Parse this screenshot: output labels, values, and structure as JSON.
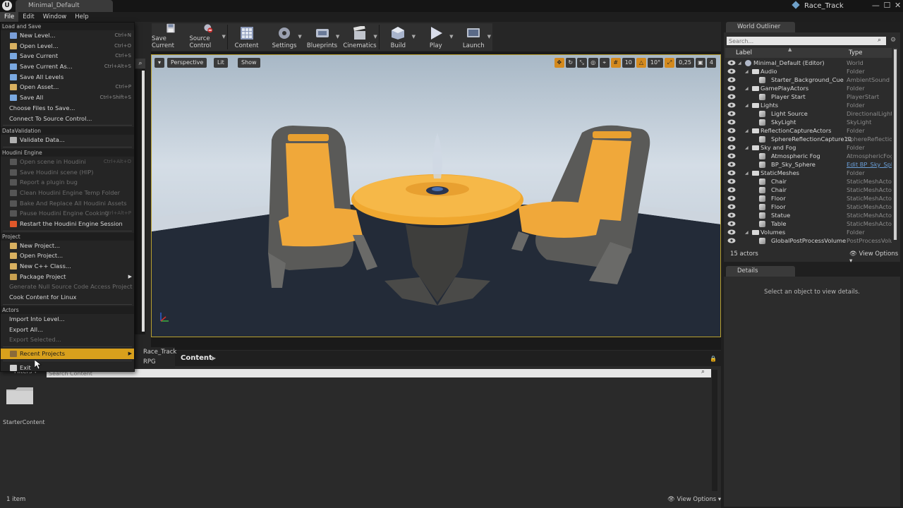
{
  "titlebar": {
    "doc_tab": "Minimal_Default",
    "project_name": "Race_Track",
    "controls": [
      "—",
      "☐",
      "✕"
    ]
  },
  "menubar": {
    "items": [
      "File",
      "Edit",
      "Window",
      "Help"
    ]
  },
  "toolbar": {
    "buttons": [
      "Save Current",
      "Source Control",
      "Content",
      "Settings",
      "Blueprints",
      "Cinematics",
      "Build",
      "Play",
      "Launch"
    ]
  },
  "viewport": {
    "perspective": "Perspective",
    "lit": "Lit",
    "show": "Show",
    "grid_snap": "10",
    "rotation_snap": "10°",
    "scale_snap": "0,25",
    "camera_speed": "4"
  },
  "file_menu": {
    "sections": {
      "load_save": "Load and Save",
      "data_validation": "DataValidation",
      "houdini": "Houdini Engine",
      "project": "Project",
      "actors": "Actors"
    },
    "load_save": [
      {
        "label": "New Level...",
        "shortcut": "Ctrl+N"
      },
      {
        "label": "Open Level...",
        "shortcut": "Ctrl+O"
      },
      {
        "label": "Save Current",
        "shortcut": "Ctrl+S"
      },
      {
        "label": "Save Current As...",
        "shortcut": "Ctrl+Alt+S"
      },
      {
        "label": "Save All Levels",
        "shortcut": ""
      },
      {
        "label": "Open Asset...",
        "shortcut": "Ctrl+P"
      },
      {
        "label": "Save All",
        "shortcut": "Ctrl+Shift+S"
      },
      {
        "label": "Choose Files to Save...",
        "shortcut": ""
      },
      {
        "label": "Connect To Source Control...",
        "shortcut": ""
      }
    ],
    "data_validation": [
      {
        "label": "Validate Data..."
      }
    ],
    "houdini": [
      {
        "label": "Open scene in Houdini",
        "shortcut": "Ctrl+Alt+O"
      },
      {
        "label": "Save Houdini scene (HIP)",
        "shortcut": ""
      },
      {
        "label": "Report a plugin bug",
        "shortcut": ""
      },
      {
        "label": "Clean Houdini Engine Temp Folder",
        "shortcut": ""
      },
      {
        "label": "Bake And Replace All Houdini Assets",
        "shortcut": ""
      },
      {
        "label": "Pause Houdini Engine Cooking",
        "shortcut": "Ctrl+Alt+P"
      },
      {
        "label": "Restart the Houdini Engine Session",
        "shortcut": ""
      }
    ],
    "project": [
      {
        "label": "New Project..."
      },
      {
        "label": "Open Project..."
      },
      {
        "label": "New C++ Class..."
      },
      {
        "label": "Package Project"
      },
      {
        "label": "Generate Null Source Code Access Project"
      },
      {
        "label": "Cook Content for Linux"
      }
    ],
    "actors": [
      {
        "label": "Import Into Level..."
      },
      {
        "label": "Export All..."
      },
      {
        "label": "Export Selected..."
      }
    ],
    "recent_projects": "Recent Projects",
    "exit": "Exit"
  },
  "recent_projects_list": [
    "Race_Track",
    "RPG"
  ],
  "content_browser": {
    "title": "Content",
    "filters": "Filters",
    "search_placeholder": "Search Content",
    "folder": "StarterContent",
    "status": "1 item",
    "view_options": "View Options"
  },
  "world_outliner": {
    "tab": "World Outliner",
    "search_placeholder": "Search...",
    "col_label": "Label",
    "col_type": "Type",
    "rows": [
      {
        "label": "Minimal_Default (Editor)",
        "type": "World",
        "depth": 0,
        "kind": "world",
        "expand": true
      },
      {
        "label": "Audio",
        "type": "Folder",
        "depth": 1,
        "kind": "folder",
        "expand": true
      },
      {
        "label": "Starter_Background_Cue",
        "type": "AmbientSound",
        "depth": 2,
        "kind": "actor"
      },
      {
        "label": "GamePlayActors",
        "type": "Folder",
        "depth": 1,
        "kind": "folder",
        "expand": true
      },
      {
        "label": "Player Start",
        "type": "PlayerStart",
        "depth": 2,
        "kind": "actor"
      },
      {
        "label": "Lights",
        "type": "Folder",
        "depth": 1,
        "kind": "folder",
        "expand": true
      },
      {
        "label": "Light Source",
        "type": "DirectionalLight",
        "depth": 2,
        "kind": "actor"
      },
      {
        "label": "SkyLight",
        "type": "SkyLight",
        "depth": 2,
        "kind": "actor"
      },
      {
        "label": "ReflectionCaptureActors",
        "type": "Folder",
        "depth": 1,
        "kind": "folder",
        "expand": true
      },
      {
        "label": "SphereReflectionCapture10",
        "type": "SphereReflectionC",
        "depth": 2,
        "kind": "actor"
      },
      {
        "label": "Sky and Fog",
        "type": "Folder",
        "depth": 1,
        "kind": "folder",
        "expand": true
      },
      {
        "label": "Atmospheric Fog",
        "type": "AtmosphericFog",
        "depth": 2,
        "kind": "actor"
      },
      {
        "label": "BP_Sky_Sphere",
        "type": "Edit BP_Sky_Sph",
        "depth": 2,
        "kind": "actor",
        "link": true
      },
      {
        "label": "StaticMeshes",
        "type": "Folder",
        "depth": 1,
        "kind": "folder",
        "expand": true
      },
      {
        "label": "Chair",
        "type": "StaticMeshActor",
        "depth": 2,
        "kind": "actor"
      },
      {
        "label": "Chair",
        "type": "StaticMeshActor",
        "depth": 2,
        "kind": "actor"
      },
      {
        "label": "Floor",
        "type": "StaticMeshActor",
        "depth": 2,
        "kind": "actor"
      },
      {
        "label": "Floor",
        "type": "StaticMeshActor",
        "depth": 2,
        "kind": "actor"
      },
      {
        "label": "Statue",
        "type": "StaticMeshActor",
        "depth": 2,
        "kind": "actor"
      },
      {
        "label": "Table",
        "type": "StaticMeshActor",
        "depth": 2,
        "kind": "actor"
      },
      {
        "label": "Volumes",
        "type": "Folder",
        "depth": 1,
        "kind": "folder",
        "expand": true
      },
      {
        "label": "GlobalPostProcessVolume",
        "type": "PostProcessVolu",
        "depth": 2,
        "kind": "actor"
      }
    ],
    "count": "15 actors",
    "view_options": "View Options"
  },
  "details": {
    "tab": "Details",
    "message": "Select an object to view details."
  },
  "colors": {
    "accent": "#d8a01c",
    "link": "#6a9fd8",
    "chair_orange": "#f0a83a"
  }
}
